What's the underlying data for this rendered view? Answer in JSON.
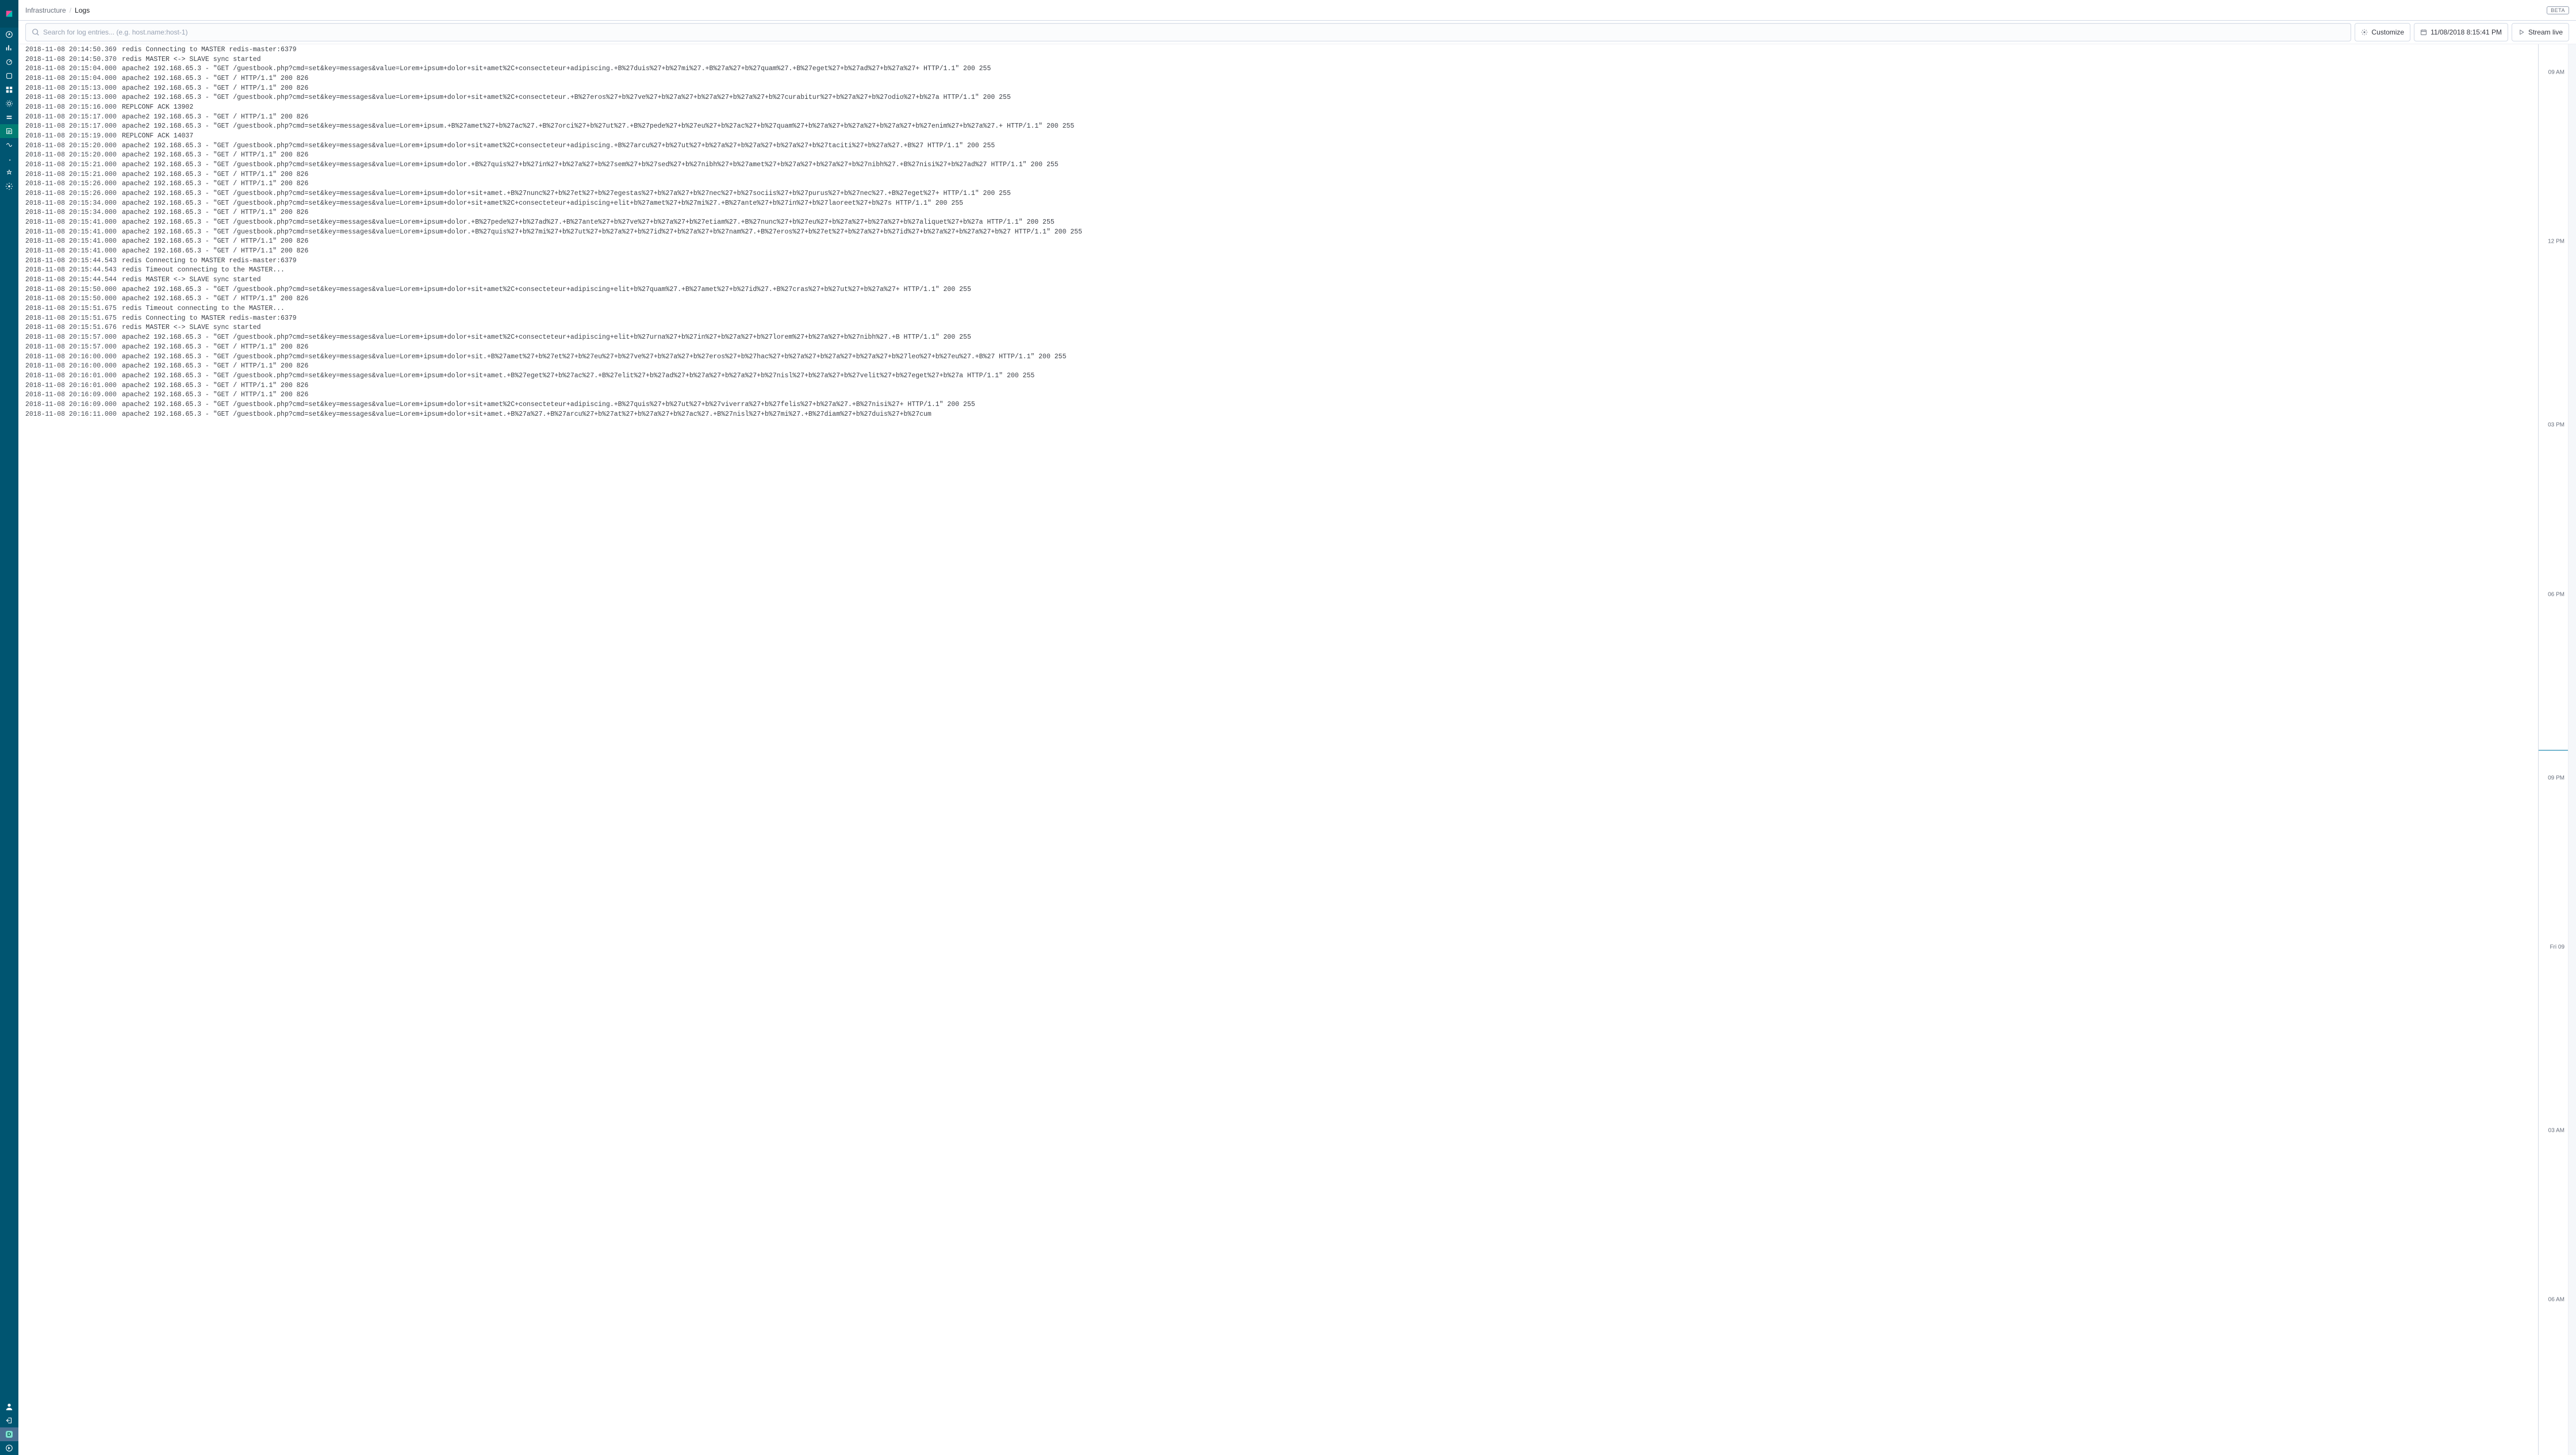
{
  "breadcrumb": {
    "root": "Infrastructure",
    "current": "Logs",
    "beta": "BETA"
  },
  "search": {
    "placeholder": "Search for log entries... (e.g. host.name:host-1)"
  },
  "toolbar": {
    "customize": "Customize",
    "timestamp": "11/08/2018 8:15:41 PM",
    "stream": "Stream live"
  },
  "minimap": {
    "ticks": [
      {
        "label": "09 AM",
        "pct": 2
      },
      {
        "label": "12 PM",
        "pct": 14
      },
      {
        "label": "03 PM",
        "pct": 27
      },
      {
        "label": "06 PM",
        "pct": 39
      },
      {
        "label": "09 PM",
        "pct": 52
      },
      {
        "label": "Fri 09",
        "pct": 64
      },
      {
        "label": "03 AM",
        "pct": 77
      },
      {
        "label": "06 AM",
        "pct": 89
      }
    ],
    "cursor_pct": 50
  },
  "logs": [
    {
      "ts": "2018-11-08 20:14:50.369",
      "msg": "redis Connecting to MASTER redis-master:6379"
    },
    {
      "ts": "2018-11-08 20:14:50.370",
      "msg": "redis MASTER <-> SLAVE sync started"
    },
    {
      "ts": "2018-11-08 20:15:04.000",
      "msg": "apache2 192.168.65.3 - \"GET /guestbook.php?cmd=set&key=messages&value=Lorem+ipsum+dolor+sit+amet%2C+consecteteur+adipiscing.+B%27duis%27+b%27mi%27.+B%27a%27+b%27quam%27.+B%27eget%27+b%27ad%27+b%27a%27+ HTTP/1.1\" 200 255"
    },
    {
      "ts": "2018-11-08 20:15:04.000",
      "msg": "apache2 192.168.65.3 - \"GET / HTTP/1.1\" 200 826"
    },
    {
      "ts": "2018-11-08 20:15:13.000",
      "msg": "apache2 192.168.65.3 - \"GET / HTTP/1.1\" 200 826"
    },
    {
      "ts": "2018-11-08 20:15:13.000",
      "msg": "apache2 192.168.65.3 - \"GET /guestbook.php?cmd=set&key=messages&value=Lorem+ipsum+dolor+sit+amet%2C+consecteteur.+B%27eros%27+b%27ve%27+b%27a%27+b%27a%27+b%27a%27+b%27curabitur%27+b%27a%27+b%27odio%27+b%27a HTTP/1.1\" 200 255"
    },
    {
      "ts": "2018-11-08 20:15:16.000",
      "msg": "REPLCONF ACK 13902"
    },
    {
      "ts": "2018-11-08 20:15:17.000",
      "msg": "apache2 192.168.65.3 - \"GET / HTTP/1.1\" 200 826"
    },
    {
      "ts": "2018-11-08 20:15:17.000",
      "msg": "apache2 192.168.65.3 - \"GET /guestbook.php?cmd=set&key=messages&value=Lorem+ipsum.+B%27amet%27+b%27ac%27.+B%27orci%27+b%27ut%27.+B%27pede%27+b%27eu%27+b%27ac%27+b%27quam%27+b%27a%27+b%27a%27+b%27a%27+b%27enim%27+b%27a%27.+ HTTP/1.1\" 200 255"
    },
    {
      "ts": "2018-11-08 20:15:19.000",
      "msg": "REPLCONF ACK 14037"
    },
    {
      "ts": "2018-11-08 20:15:20.000",
      "msg": "apache2 192.168.65.3 - \"GET /guestbook.php?cmd=set&key=messages&value=Lorem+ipsum+dolor+sit+amet%2C+consecteteur+adipiscing.+B%27arcu%27+b%27ut%27+b%27a%27+b%27a%27+b%27a%27+b%27taciti%27+b%27a%27.+B%27 HTTP/1.1\" 200 255"
    },
    {
      "ts": "2018-11-08 20:15:20.000",
      "msg": "apache2 192.168.65.3 - \"GET / HTTP/1.1\" 200 826"
    },
    {
      "ts": "2018-11-08 20:15:21.000",
      "msg": "apache2 192.168.65.3 - \"GET /guestbook.php?cmd=set&key=messages&value=Lorem+ipsum+dolor.+B%27quis%27+b%27in%27+b%27a%27+b%27sem%27+b%27sed%27+b%27nibh%27+b%27amet%27+b%27a%27+b%27a%27+b%27nibh%27.+B%27nisi%27+b%27ad%27 HTTP/1.1\" 200 255"
    },
    {
      "ts": "2018-11-08 20:15:21.000",
      "msg": "apache2 192.168.65.3 - \"GET / HTTP/1.1\" 200 826"
    },
    {
      "ts": "2018-11-08 20:15:26.000",
      "msg": "apache2 192.168.65.3 - \"GET / HTTP/1.1\" 200 826"
    },
    {
      "ts": "2018-11-08 20:15:26.000",
      "msg": "apache2 192.168.65.3 - \"GET /guestbook.php?cmd=set&key=messages&value=Lorem+ipsum+dolor+sit+amet.+B%27nunc%27+b%27et%27+b%27egestas%27+b%27a%27+b%27nec%27+b%27sociis%27+b%27purus%27+b%27nec%27.+B%27eget%27+ HTTP/1.1\" 200 255"
    },
    {
      "ts": "2018-11-08 20:15:34.000",
      "msg": "apache2 192.168.65.3 - \"GET /guestbook.php?cmd=set&key=messages&value=Lorem+ipsum+dolor+sit+amet%2C+consecteteur+adipiscing+elit+b%27amet%27+b%27mi%27.+B%27ante%27+b%27in%27+b%27laoreet%27+b%27s HTTP/1.1\" 200 255"
    },
    {
      "ts": "2018-11-08 20:15:34.000",
      "msg": "apache2 192.168.65.3 - \"GET / HTTP/1.1\" 200 826"
    },
    {
      "ts": "2018-11-08 20:15:41.000",
      "msg": "apache2 192.168.65.3 - \"GET /guestbook.php?cmd=set&key=messages&value=Lorem+ipsum+dolor.+B%27pede%27+b%27ad%27.+B%27ante%27+b%27ve%27+b%27a%27+b%27etiam%27.+B%27nunc%27+b%27eu%27+b%27a%27+b%27a%27+b%27aliquet%27+b%27a HTTP/1.1\" 200 255"
    },
    {
      "ts": "2018-11-08 20:15:41.000",
      "msg": "apache2 192.168.65.3 - \"GET /guestbook.php?cmd=set&key=messages&value=Lorem+ipsum+dolor.+B%27quis%27+b%27mi%27+b%27ut%27+b%27a%27+b%27id%27+b%27a%27+b%27nam%27.+B%27eros%27+b%27et%27+b%27a%27+b%27id%27+b%27a%27+b%27a%27+b%27 HTTP/1.1\" 200 255"
    },
    {
      "ts": "2018-11-08 20:15:41.000",
      "msg": "apache2 192.168.65.3 - \"GET / HTTP/1.1\" 200 826"
    },
    {
      "ts": "2018-11-08 20:15:41.000",
      "msg": "apache2 192.168.65.3 - \"GET / HTTP/1.1\" 200 826"
    },
    {
      "ts": "2018-11-08 20:15:44.543",
      "msg": "redis Connecting to MASTER redis-master:6379"
    },
    {
      "ts": "2018-11-08 20:15:44.543",
      "msg": "redis Timeout connecting to the MASTER..."
    },
    {
      "ts": "2018-11-08 20:15:44.544",
      "msg": "redis MASTER <-> SLAVE sync started"
    },
    {
      "ts": "2018-11-08 20:15:50.000",
      "msg": "apache2 192.168.65.3 - \"GET /guestbook.php?cmd=set&key=messages&value=Lorem+ipsum+dolor+sit+amet%2C+consecteteur+adipiscing+elit+b%27quam%27.+B%27amet%27+b%27id%27.+B%27cras%27+b%27ut%27+b%27a%27+ HTTP/1.1\" 200 255"
    },
    {
      "ts": "2018-11-08 20:15:50.000",
      "msg": "apache2 192.168.65.3 - \"GET / HTTP/1.1\" 200 826"
    },
    {
      "ts": "2018-11-08 20:15:51.675",
      "msg": "redis Timeout connecting to the MASTER..."
    },
    {
      "ts": "2018-11-08 20:15:51.675",
      "msg": "redis Connecting to MASTER redis-master:6379"
    },
    {
      "ts": "2018-11-08 20:15:51.676",
      "msg": "redis MASTER <-> SLAVE sync started"
    },
    {
      "ts": "2018-11-08 20:15:57.000",
      "msg": "apache2 192.168.65.3 - \"GET /guestbook.php?cmd=set&key=messages&value=Lorem+ipsum+dolor+sit+amet%2C+consecteteur+adipiscing+elit+b%27urna%27+b%27in%27+b%27a%27+b%27lorem%27+b%27a%27+b%27nibh%27.+B HTTP/1.1\" 200 255"
    },
    {
      "ts": "2018-11-08 20:15:57.000",
      "msg": "apache2 192.168.65.3 - \"GET / HTTP/1.1\" 200 826"
    },
    {
      "ts": "2018-11-08 20:16:00.000",
      "msg": "apache2 192.168.65.3 - \"GET /guestbook.php?cmd=set&key=messages&value=Lorem+ipsum+dolor+sit.+B%27amet%27+b%27et%27+b%27eu%27+b%27ve%27+b%27a%27+b%27eros%27+b%27hac%27+b%27a%27+b%27a%27+b%27a%27+b%27leo%27+b%27eu%27.+B%27 HTTP/1.1\" 200 255"
    },
    {
      "ts": "2018-11-08 20:16:00.000",
      "msg": "apache2 192.168.65.3 - \"GET / HTTP/1.1\" 200 826"
    },
    {
      "ts": "2018-11-08 20:16:01.000",
      "msg": "apache2 192.168.65.3 - \"GET /guestbook.php?cmd=set&key=messages&value=Lorem+ipsum+dolor+sit+amet.+B%27eget%27+b%27ac%27.+B%27elit%27+b%27ad%27+b%27a%27+b%27a%27+b%27nisl%27+b%27a%27+b%27velit%27+b%27eget%27+b%27a HTTP/1.1\" 200 255"
    },
    {
      "ts": "2018-11-08 20:16:01.000",
      "msg": "apache2 192.168.65.3 - \"GET / HTTP/1.1\" 200 826"
    },
    {
      "ts": "2018-11-08 20:16:09.000",
      "msg": "apache2 192.168.65.3 - \"GET / HTTP/1.1\" 200 826"
    },
    {
      "ts": "2018-11-08 20:16:09.000",
      "msg": "apache2 192.168.65.3 - \"GET /guestbook.php?cmd=set&key=messages&value=Lorem+ipsum+dolor+sit+amet%2C+consecteteur+adipiscing.+B%27quis%27+b%27ut%27+b%27viverra%27+b%27felis%27+b%27a%27.+B%27nisi%27+ HTTP/1.1\" 200 255"
    },
    {
      "ts": "2018-11-08 20:16:11.000",
      "msg": "apache2 192.168.65.3 - \"GET /guestbook.php?cmd=set&key=messages&value=Lorem+ipsum+dolor+sit+amet.+B%27a%27.+B%27arcu%27+b%27at%27+b%27a%27+b%27ac%27.+B%27nisl%27+b%27mi%27.+B%27diam%27+b%27duis%27+b%27cum"
    }
  ]
}
